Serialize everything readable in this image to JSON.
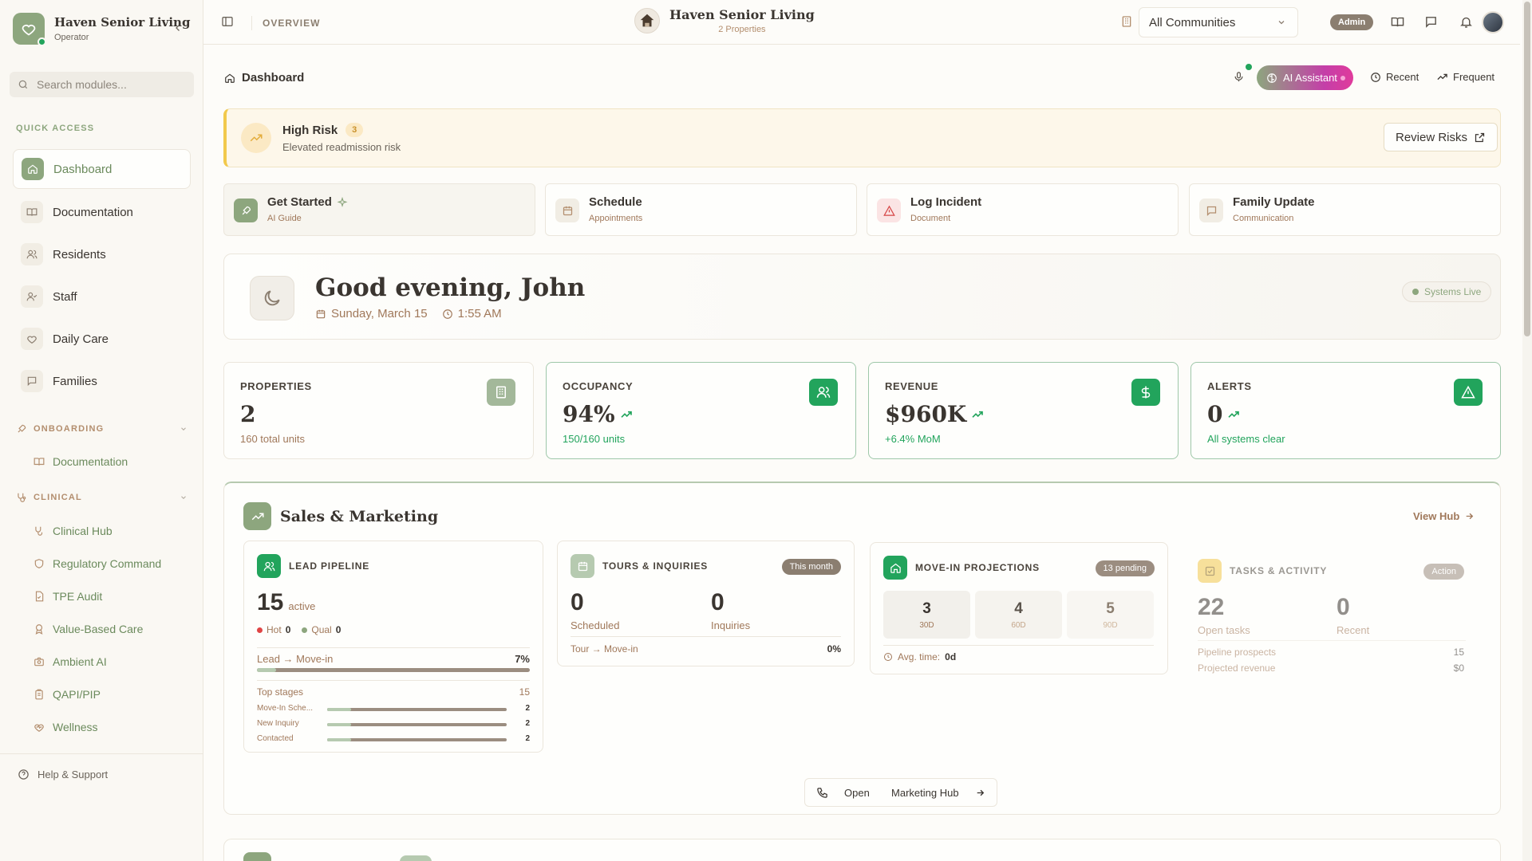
{
  "sidebar": {
    "brand_name": "Haven Senior Living",
    "brand_role": "Operator",
    "search_placeholder": "Search modules...",
    "quick_access_label": "QUICK ACCESS",
    "quick_items": [
      {
        "label": "Dashboard",
        "icon": "home-icon"
      },
      {
        "label": "Documentation",
        "icon": "book-icon"
      },
      {
        "label": "Residents",
        "icon": "users-icon"
      },
      {
        "label": "Staff",
        "icon": "user-check-icon"
      },
      {
        "label": "Daily Care",
        "icon": "heart-icon"
      },
      {
        "label": "Families",
        "icon": "message-icon"
      }
    ],
    "onboarding_label": "ONBOARDING",
    "onboarding_items": [
      "Documentation"
    ],
    "clinical_label": "CLINICAL",
    "clinical_items": [
      "Clinical Hub",
      "Regulatory Command",
      "TPE Audit",
      "Value-Based Care",
      "Ambient AI",
      "QAPI/PIP",
      "Wellness"
    ],
    "help_label": "Help & Support"
  },
  "topbar": {
    "overview_label": "OVERVIEW",
    "brand_name": "Haven Senior Living",
    "brand_sub": "2 Properties",
    "community_value": "All Communities",
    "admin_badge": "Admin"
  },
  "main": {
    "breadcrumb": "Dashboard",
    "ai_assistant_label": "AI Assistant",
    "recent_label": "Recent",
    "frequent_label": "Frequent",
    "risk": {
      "title": "High Risk",
      "count": "3",
      "subtitle": "Elevated readmission risk",
      "button": "Review Risks"
    },
    "quick_actions": [
      {
        "title": "Get Started",
        "sub": "AI Guide"
      },
      {
        "title": "Schedule",
        "sub": "Appointments"
      },
      {
        "title": "Log Incident",
        "sub": "Document"
      },
      {
        "title": "Family Update",
        "sub": "Communication"
      }
    ],
    "greeting": {
      "title": "Good evening, John",
      "date": "Sunday, March 15",
      "time": "1:55 AM",
      "status": "Systems Live"
    },
    "stats": [
      {
        "label": "PROPERTIES",
        "value": "2",
        "sub": "160 total units"
      },
      {
        "label": "OCCUPANCY",
        "value": "94%",
        "sub": "150/160 units"
      },
      {
        "label": "REVENUE",
        "value": "$960K",
        "sub": "+6.4% MoM"
      },
      {
        "label": "ALERTS",
        "value": "0",
        "sub": "All systems clear"
      }
    ],
    "sales": {
      "title": "Sales & Marketing",
      "view_hub": "View Hub",
      "lead_pipeline": {
        "title": "LEAD PIPELINE",
        "value": "15",
        "unit": "active",
        "hot_label": "Hot",
        "hot_value": "0",
        "qual_label": "Qual",
        "qual_value": "0",
        "conversion_label": "Lead → Move-in",
        "conversion_value": "7%",
        "conversion_fraction": 0.07,
        "top_stages_label": "Top stages",
        "top_stages_value": "15",
        "stages": [
          {
            "name": "Move-In Sche...",
            "value": "2"
          },
          {
            "name": "New Inquiry",
            "value": "2"
          },
          {
            "name": "Contacted",
            "value": "2"
          }
        ]
      },
      "tours": {
        "title": "TOURS & INQUIRIES",
        "badge": "This month",
        "scheduled_value": "0",
        "scheduled_label": "Scheduled",
        "inquiries_value": "0",
        "inquiries_label": "Inquiries",
        "conversion_label": "Tour → Move-in",
        "conversion_value": "0%"
      },
      "movein": {
        "title": "MOVE-IN PROJECTIONS",
        "badge": "13 pending",
        "cells": [
          {
            "value": "3",
            "label": "30D"
          },
          {
            "value": "4",
            "label": "60D"
          },
          {
            "value": "5",
            "label": "90D"
          }
        ],
        "avg_label": "Avg. time:",
        "avg_value": "0d"
      },
      "tasks": {
        "title": "TASKS & ACTIVITY",
        "badge": "Action",
        "open_value": "22",
        "open_label": "Open tasks",
        "recent_value": "0",
        "recent_label": "Recent",
        "rows": [
          {
            "label": "Pipeline prospects",
            "value": "15"
          },
          {
            "label": "Projected revenue",
            "value": "$0"
          }
        ]
      },
      "open_button_prefix": "Open",
      "open_button_label": "Marketing Hub"
    }
  },
  "colors": {
    "accent": "#8da67e",
    "green": "#22a45c",
    "warning": "#f2c94c",
    "brown": "#a0785a"
  }
}
